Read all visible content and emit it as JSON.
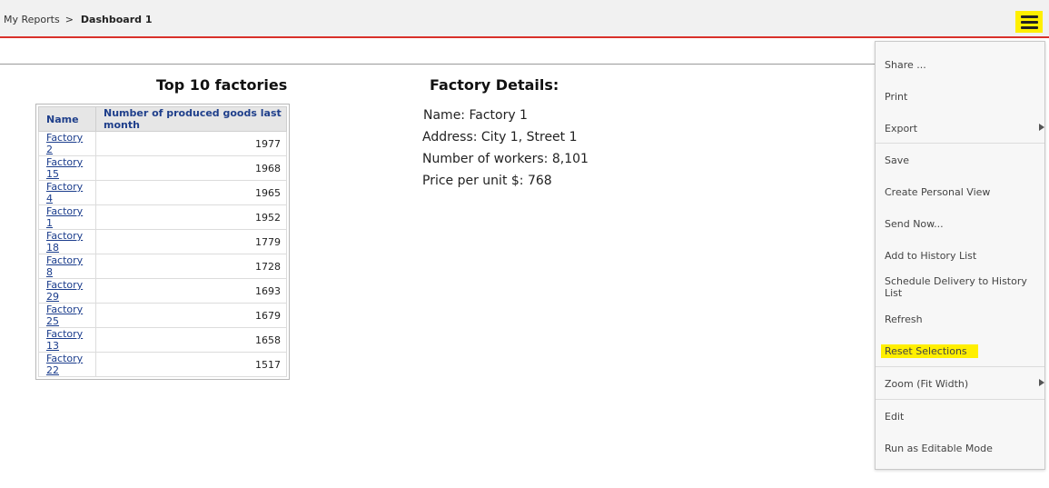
{
  "breadcrumb": {
    "parent": "My Reports",
    "separator": ">",
    "current": "Dashboard 1"
  },
  "menu_button": {
    "icon": "hamburger-icon",
    "highlight_color": "#ffef00"
  },
  "top_factories": {
    "title": "Top 10 factories",
    "columns": [
      "Name",
      "Number of produced goods last month"
    ],
    "rows": [
      {
        "name": "Factory 2",
        "value": "1977"
      },
      {
        "name": "Factory 15",
        "value": "1968"
      },
      {
        "name": "Factory 4",
        "value": "1965"
      },
      {
        "name": "Factory 1",
        "value": "1952"
      },
      {
        "name": "Factory 18",
        "value": "1779"
      },
      {
        "name": "Factory 8",
        "value": "1728"
      },
      {
        "name": "Factory 29",
        "value": "1693"
      },
      {
        "name": "Factory 25",
        "value": "1679"
      },
      {
        "name": "Factory 13",
        "value": "1658"
      },
      {
        "name": "Factory 22",
        "value": "1517"
      }
    ]
  },
  "details": {
    "title": "Factory Details:",
    "name": "Name: Factory 1",
    "address": "Address: City 1, Street 1",
    "workers": "Number of workers: 8,101",
    "price": "Price per unit $: 768"
  },
  "menu": {
    "items": [
      {
        "label": "Share ..."
      },
      {
        "label": "Print"
      },
      {
        "label": "Export"
      },
      {
        "label": "Save"
      },
      {
        "label": "Create Personal View"
      },
      {
        "label": "Send Now..."
      },
      {
        "label": "Add to History List"
      },
      {
        "label": "Schedule Delivery to History List"
      },
      {
        "label": "Refresh"
      },
      {
        "label": "Reset Selections"
      },
      {
        "label": "Zoom (Fit Width)"
      },
      {
        "label": "Edit"
      },
      {
        "label": "Run as Editable Mode"
      }
    ]
  },
  "colors": {
    "accent_red": "#d9312b",
    "link_blue": "#1a3c8c",
    "highlight": "#ffef00"
  }
}
